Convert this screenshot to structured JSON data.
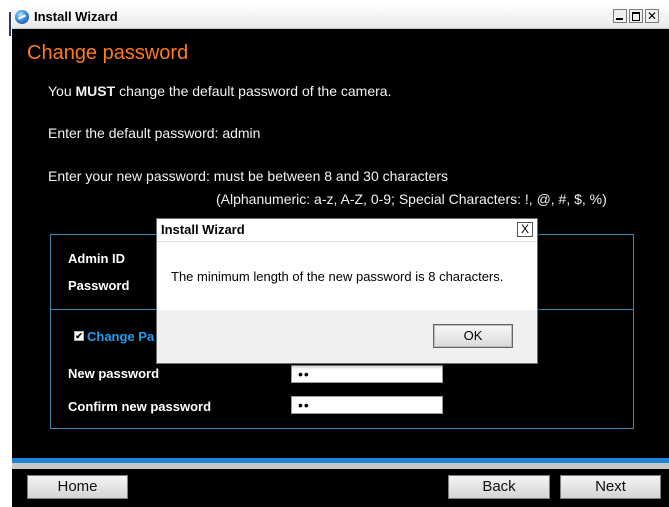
{
  "window": {
    "title": "Install Wizard"
  },
  "page": {
    "heading": "Change password",
    "must_prefix": "You ",
    "must_bold": "MUST",
    "must_suffix": " change the default password of the camera.",
    "default_pw_line": "Enter the default password: admin",
    "new_pw_line": "Enter your new password: must be between 8 and 30 characters",
    "rules_line": "(Alphanumeric: a-z, A-Z, 0-9; Special Characters: !, @, #, $, %)"
  },
  "form": {
    "admin_id_label": "Admin ID",
    "password_label": "Password",
    "change_password_label": "Change Pa",
    "change_password_checked": true,
    "checkbox_mark": "✔",
    "new_password_label": "New password",
    "new_password_value": "••",
    "confirm_password_label": "Confirm new password",
    "confirm_password_value": "••"
  },
  "footer": {
    "home_label": "Home",
    "back_label": "Back",
    "next_label": "Next"
  },
  "dialog": {
    "title": "Install Wizard",
    "close_glyph": "X",
    "message": "The minimum length of the new password is 8 characters.",
    "ok_label": "OK"
  },
  "colors": {
    "heading": "#ff7b19",
    "accent_blue": "#1e86d6",
    "panel_border": "#3d87b8",
    "background": "#000000"
  }
}
